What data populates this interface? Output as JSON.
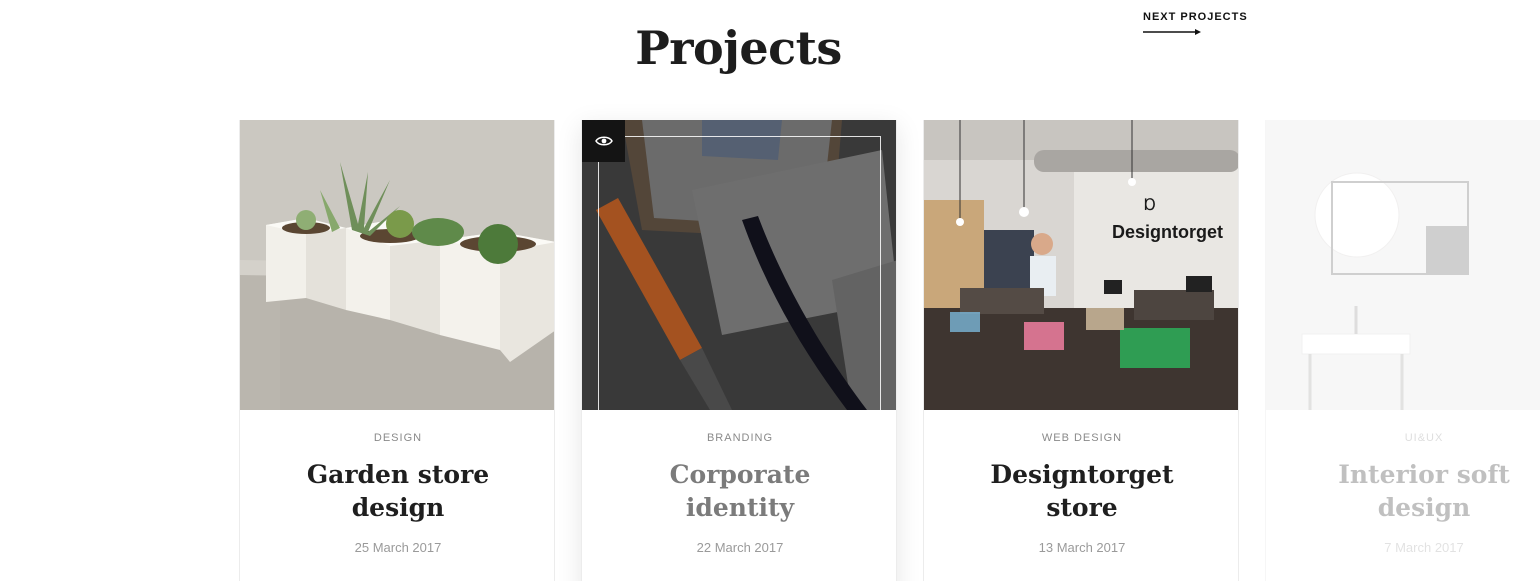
{
  "header": {
    "title": "Projects",
    "next_label": "NEXT PROJECTS"
  },
  "projects": [
    {
      "category": "DESIGN",
      "title": "Garden store design",
      "date": "25 March 2017",
      "image": "succulent-planters-photo"
    },
    {
      "category": "BRANDING",
      "title": "Corporate identity",
      "date": "22 March 2017",
      "image": "stationery-branding-photo"
    },
    {
      "category": "WEB DESIGN",
      "title": "Designtorget store",
      "date": "13 March 2017",
      "image": "store-interior-photo",
      "sign_text": "Designtorget"
    },
    {
      "category": "UI&UX",
      "title": "Interior soft design",
      "date": "7 March 2017",
      "image": "bathroom-interior-photo"
    }
  ],
  "colors": {
    "title": "#1d1d1d",
    "category": "#8a8a8a",
    "date": "#9a9a9a",
    "view_button_bg": "#141414"
  }
}
